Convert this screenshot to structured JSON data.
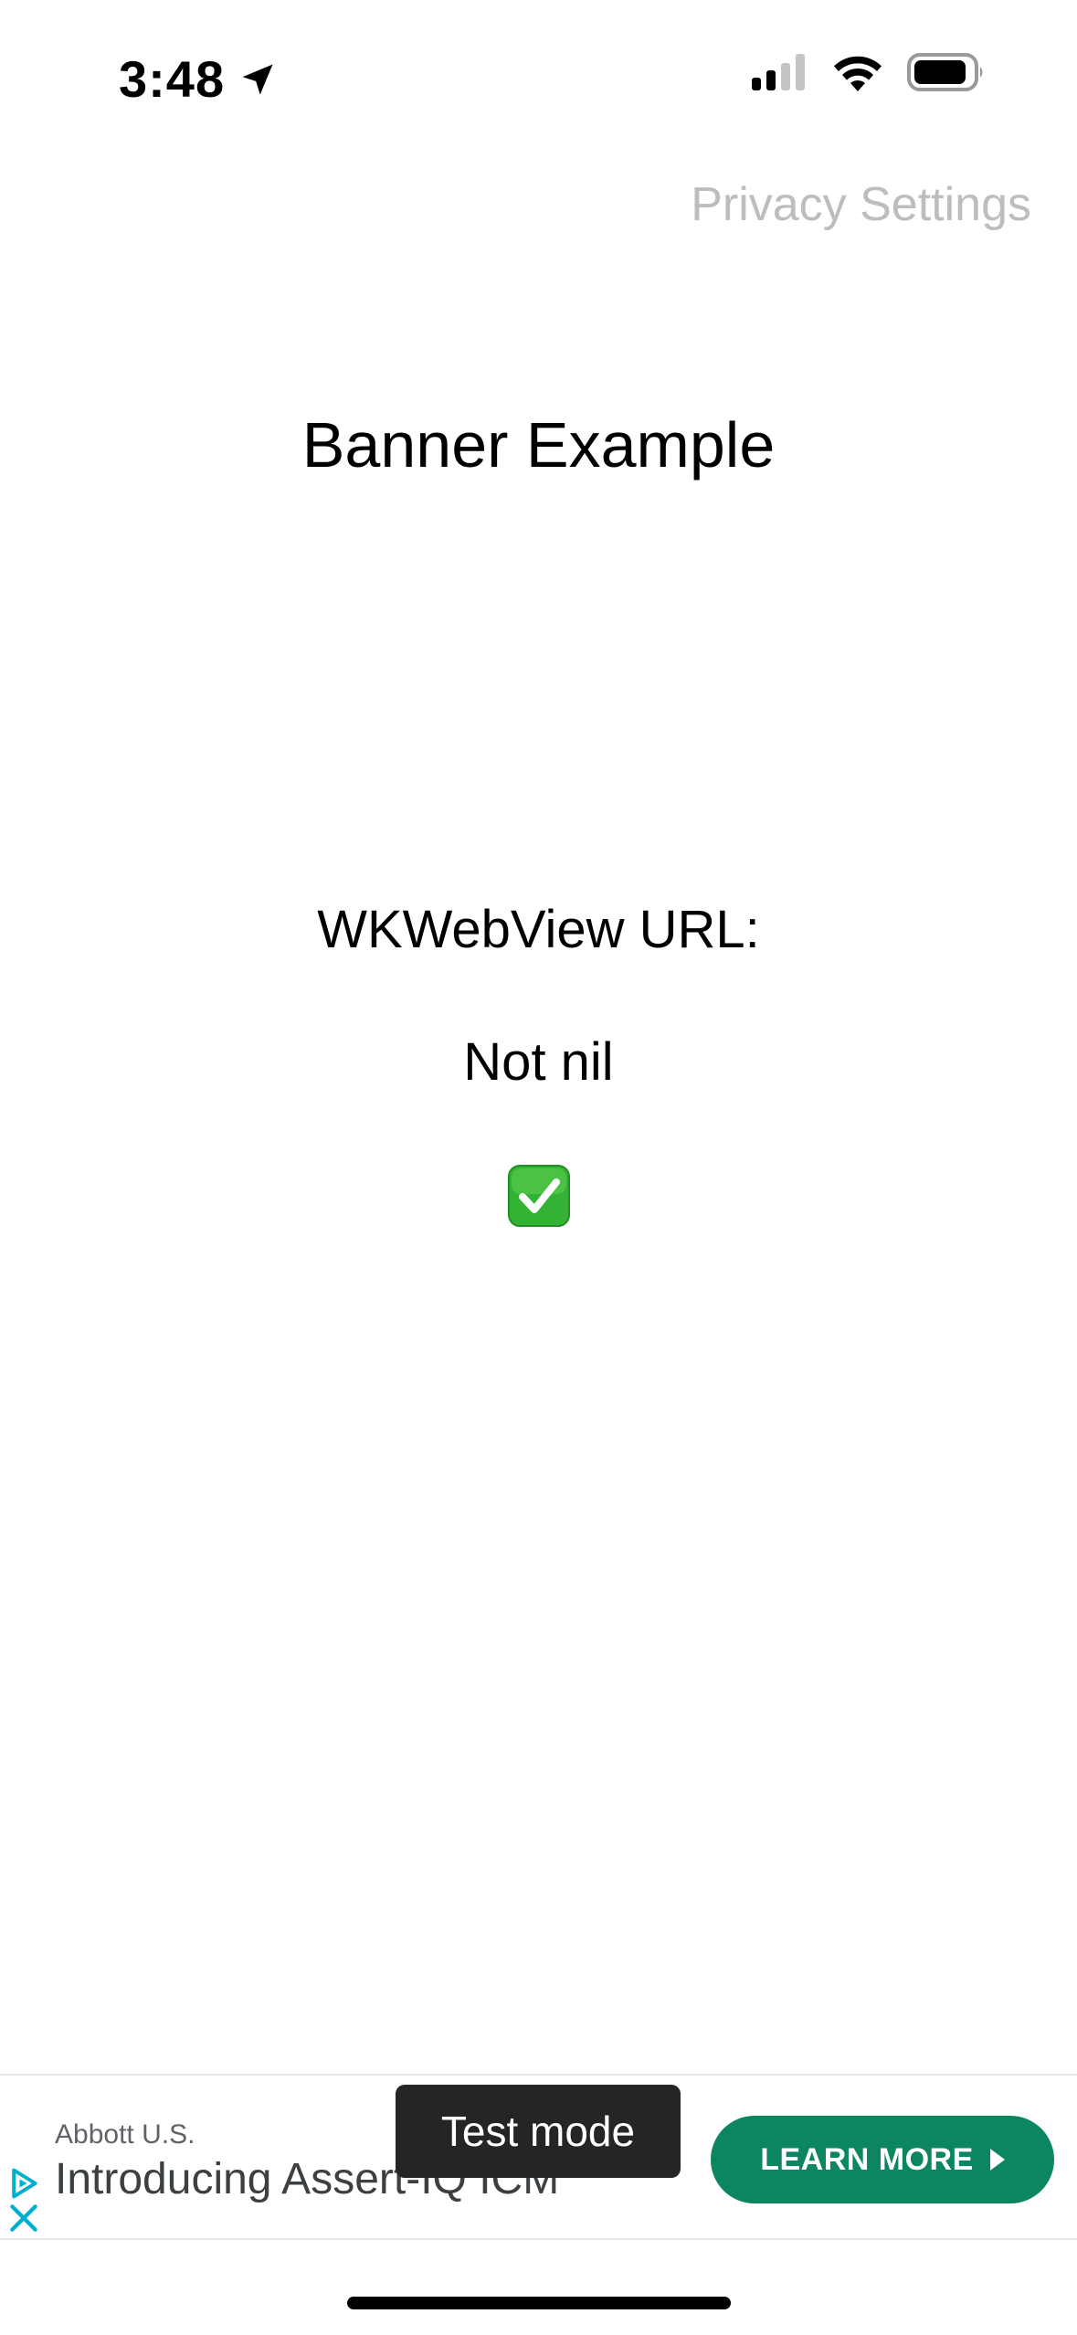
{
  "status_bar": {
    "time": "3:48",
    "icons": [
      "location-arrow-icon",
      "cellular-signal-icon",
      "wifi-icon",
      "battery-icon"
    ]
  },
  "nav": {
    "privacy_settings_label": "Privacy Settings"
  },
  "main": {
    "title": "Banner Example",
    "url_label": "WKWebView URL:",
    "url_value": "Not nil",
    "status_icon": "check-mark-icon"
  },
  "ad": {
    "advertiser": "Abbott U.S.",
    "headline": "Introducing Assert-IQ ICM",
    "cta_label": "LEARN MORE",
    "test_mode_label": "Test mode",
    "cta_color": "#0b8661"
  },
  "colors": {
    "privacy_text": "#bdbdbd",
    "check_green": "#34b233"
  }
}
